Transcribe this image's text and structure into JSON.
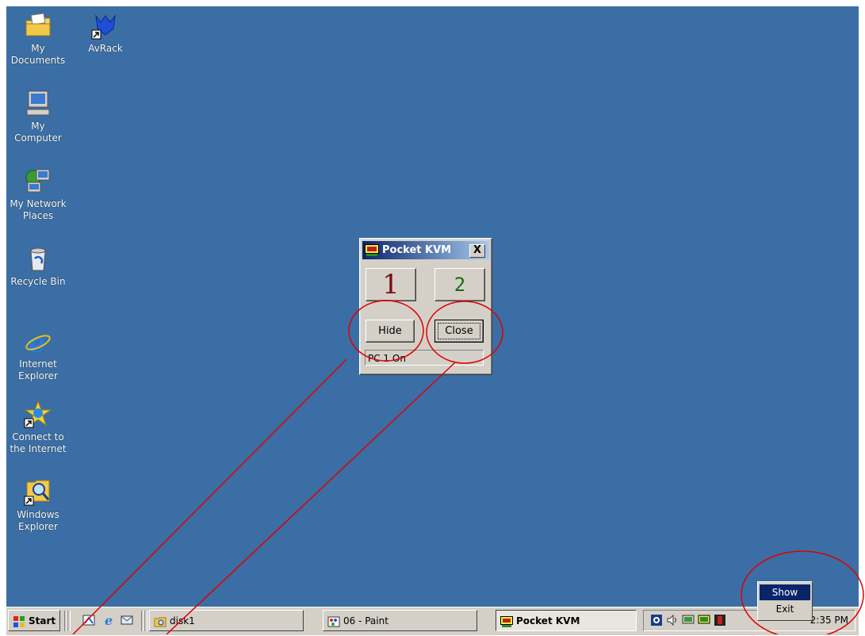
{
  "desktop_icons": [
    {
      "label": "My Documents",
      "icon": "folder-documents-icon"
    },
    {
      "label": "AvRack",
      "icon": "avrack-shortcut-icon"
    },
    {
      "label": "My Computer",
      "icon": "computer-icon"
    },
    {
      "label": "My Network\nPlaces",
      "line1": "My Network",
      "line2": "Places",
      "icon": "network-icon"
    },
    {
      "label": "Recycle Bin",
      "icon": "recycle-bin-icon"
    },
    {
      "label": "Internet Explorer",
      "line1": "Internet",
      "line2": "Explorer",
      "icon": "internet-explorer-icon"
    },
    {
      "label": "Connect to the Internet",
      "line1": "Connect to",
      "line2": "the Internet",
      "icon": "connect-wizard-icon"
    },
    {
      "label": "Windows Explorer",
      "line1": "Windows",
      "line2": "Explorer",
      "icon": "windows-explorer-icon"
    }
  ],
  "kvm_window": {
    "title": "Pocket KVM",
    "close_glyph": "X",
    "pc1": "1",
    "pc2": "2",
    "hide": "Hide",
    "close": "Close",
    "status": "PC 1 On",
    "colors": {
      "pc1": "#7a1010",
      "pc2": "#1a6a1a"
    }
  },
  "taskbar": {
    "start": "Start",
    "buttons": [
      {
        "label": "disk1",
        "icon": "folder-icon"
      },
      {
        "label": "06 - Paint",
        "icon": "paint-icon"
      },
      {
        "label": "Pocket KVM",
        "icon": "kvm-icon"
      }
    ],
    "clock": "2:35 PM"
  },
  "context_menu": {
    "items": [
      "Show",
      "Exit"
    ]
  },
  "colors": {
    "desktop": "#3a6ea5",
    "annotation": "#e00000"
  }
}
